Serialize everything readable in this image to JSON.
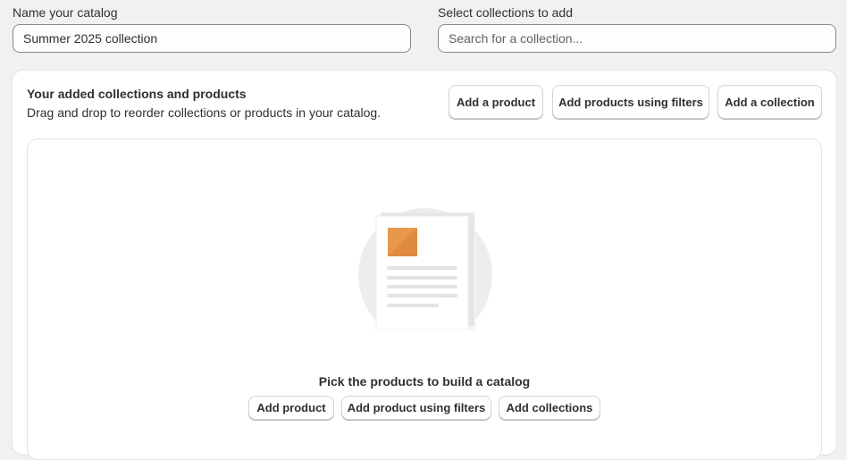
{
  "catalog_name": {
    "label": "Name your catalog",
    "value": "Summer 2025 collection"
  },
  "collections_search": {
    "label": "Select collections to add",
    "placeholder": "Search for a collection..."
  },
  "added_card": {
    "title": "Your added collections and products",
    "subtitle": "Drag and drop to reorder collections or products in your catalog.",
    "actions": {
      "add_product": "Add a product",
      "add_products_filters": "Add products using filters",
      "add_collection": "Add a collection"
    }
  },
  "empty_state": {
    "heading": "Pick the products to build a catalog",
    "illustration_icon": "catalog-document-illustration",
    "accent_color": "#e8984a",
    "actions": {
      "add_product": "Add product",
      "add_product_filters": "Add product using filters",
      "add_collections": "Add collections"
    }
  }
}
